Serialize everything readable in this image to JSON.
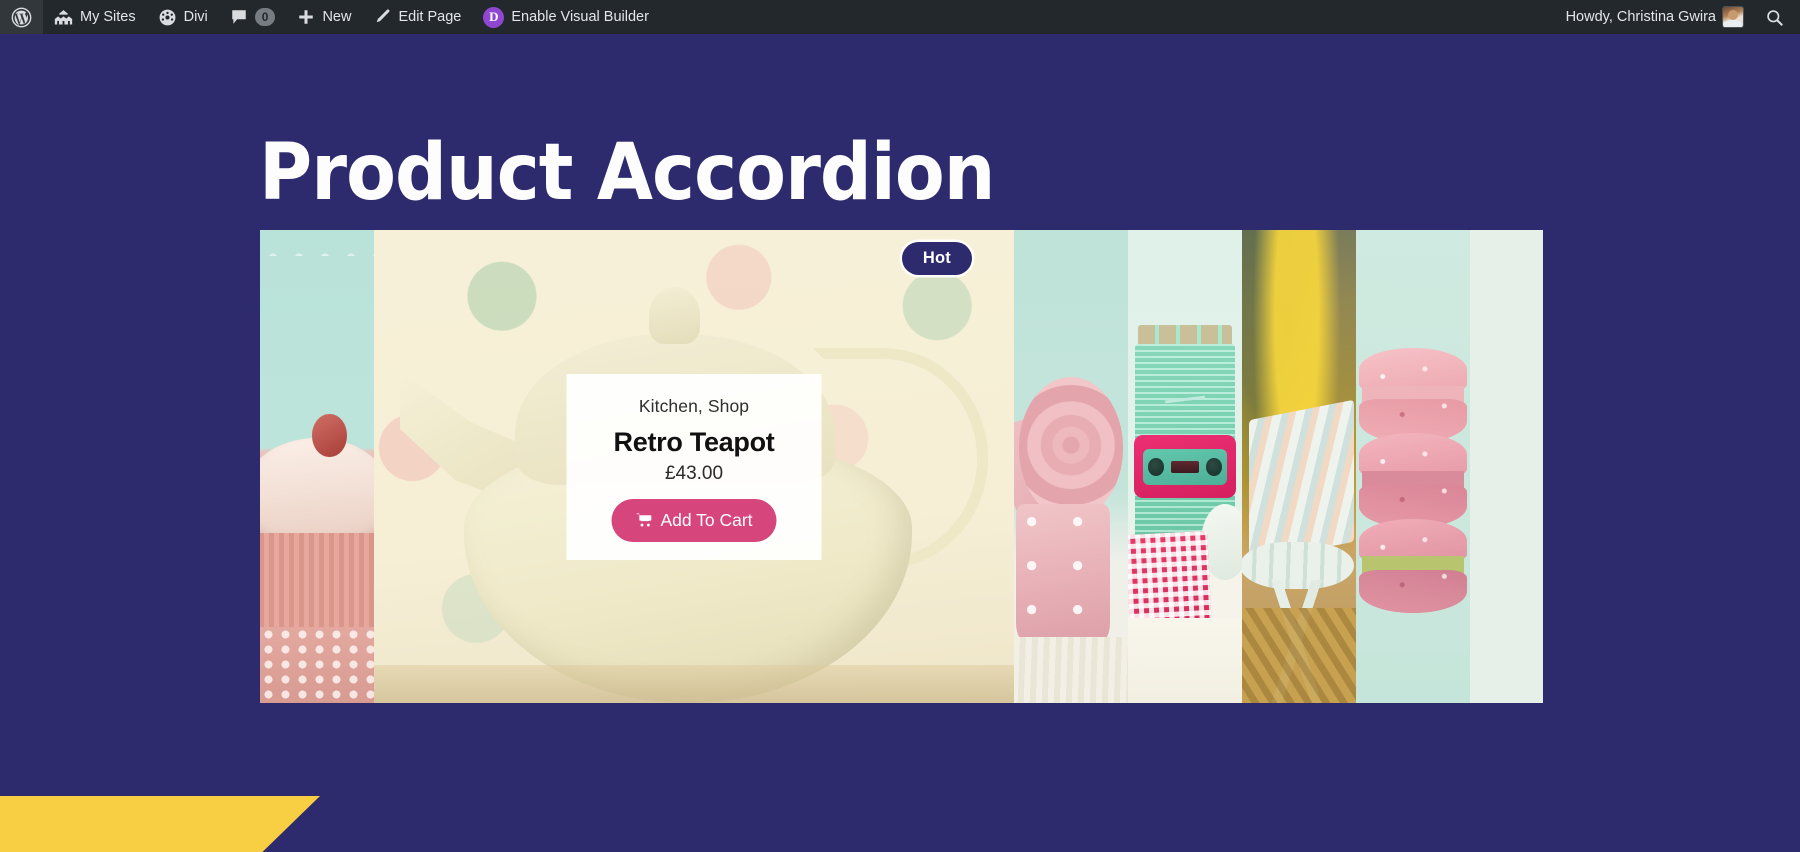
{
  "adminbar": {
    "wp_logo_label": "",
    "left_items": [
      {
        "id": "my-sites",
        "label": "My Sites",
        "icon": "sites-icon"
      },
      {
        "id": "divi",
        "label": "Divi",
        "icon": "divi-dashboard-icon"
      },
      {
        "id": "comments",
        "label": "",
        "icon": "comment-bubble-icon",
        "count": "0"
      },
      {
        "id": "new",
        "label": "New",
        "icon": "plus-icon"
      },
      {
        "id": "edit-page",
        "label": "Edit Page",
        "icon": "pencil-icon"
      },
      {
        "id": "visual-builder",
        "label": "Enable Visual Builder",
        "icon": "divi-d-badge",
        "badge_letter": "D"
      }
    ],
    "right": {
      "howdy": "Howdy, Christina Gwira",
      "search_icon": "search-icon",
      "avatar": "avatar"
    },
    "colors": {
      "bar_bg": "#23282d",
      "text": "#e3e6e8",
      "divi_purple": "#8f47d1"
    }
  },
  "page": {
    "title": "Product Accordion",
    "background_color": "#2d2a6e",
    "title_color": "#ffffff"
  },
  "accordion": {
    "panels": [
      {
        "id": "cupcake",
        "state": "collapsed",
        "image_alt": "pink-cupcake"
      },
      {
        "id": "teapot",
        "state": "expanded",
        "image_alt": "retro-teapot-polka-dot"
      },
      {
        "id": "rose",
        "state": "collapsed",
        "image_alt": "pink-rose-in-pot"
      },
      {
        "id": "radio",
        "state": "collapsed",
        "image_alt": "mint-retro-radio"
      },
      {
        "id": "chair",
        "state": "collapsed",
        "image_alt": "autumn-deck-chair"
      },
      {
        "id": "macaron",
        "state": "collapsed",
        "image_alt": "pink-macarons"
      }
    ],
    "open_panel": {
      "badge": "Hot",
      "badge_bg": "#2d2a6e",
      "category": "Kitchen, Shop",
      "product_title": "Retro Teapot",
      "price": "£43.00",
      "add_to_cart_label": "Add To Cart",
      "cart_icon": "shopping-cart-icon",
      "button_color": "#d6457b"
    }
  },
  "decor": {
    "yellow_banner_color": "#f8cf42"
  }
}
